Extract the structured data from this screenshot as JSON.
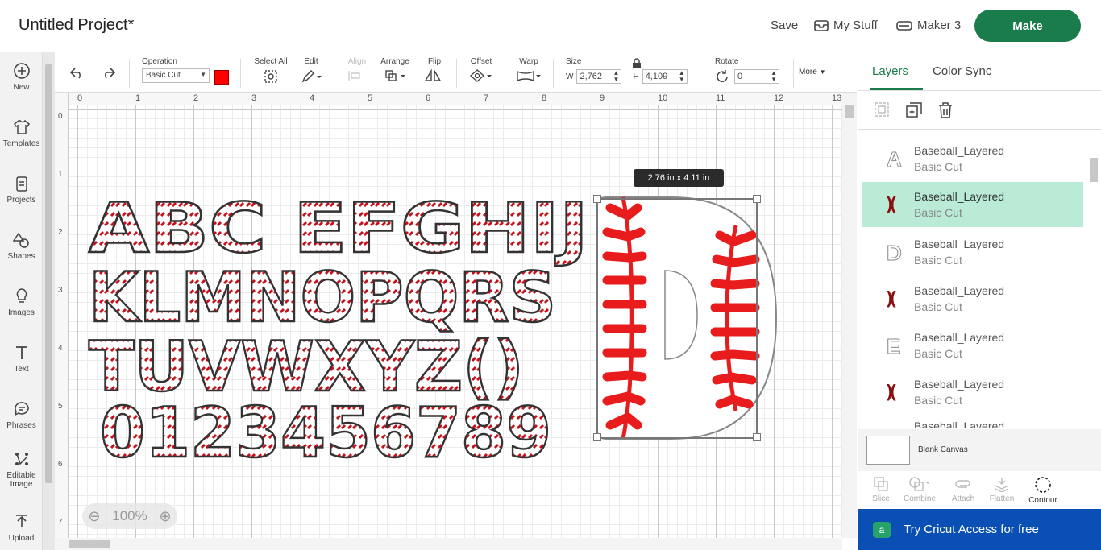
{
  "header": {
    "title": "Untitled Project*",
    "save": "Save",
    "my_stuff": "My Stuff",
    "machine": "Maker 3",
    "make": "Make"
  },
  "sidebar": {
    "items": [
      {
        "label": "New",
        "icon": "plus-circle-icon"
      },
      {
        "label": "Templates",
        "icon": "shirt-icon"
      },
      {
        "label": "Projects",
        "icon": "clipboard-icon"
      },
      {
        "label": "Shapes",
        "icon": "shapes-icon"
      },
      {
        "label": "Images",
        "icon": "lightbulb-icon"
      },
      {
        "label": "Text",
        "icon": "text-icon"
      },
      {
        "label": "Phrases",
        "icon": "chat-icon"
      },
      {
        "label": "Editable Image",
        "icon": "editable-image-icon"
      },
      {
        "label": "Upload",
        "icon": "upload-icon"
      }
    ]
  },
  "toolbar": {
    "operation_label": "Operation",
    "operation_value": "Basic Cut",
    "operation_color": "#ff0000",
    "select_all": "Select All",
    "edit": "Edit",
    "align": "Align",
    "arrange": "Arrange",
    "flip": "Flip",
    "offset": "Offset",
    "warp": "Warp",
    "size": "Size",
    "w_label": "W",
    "w_value": "2,762",
    "h_label": "H",
    "h_value": "4,109",
    "rotate": "Rotate",
    "rotate_value": "0",
    "more": "More"
  },
  "rulers": {
    "top": [
      "0",
      "1",
      "2",
      "3",
      "4",
      "5",
      "6",
      "7",
      "8",
      "9",
      "10",
      "11",
      "12",
      "13"
    ],
    "left": [
      "0",
      "1",
      "2",
      "3",
      "4",
      "5",
      "6",
      "7"
    ]
  },
  "canvas": {
    "zoom": "100%",
    "size_tooltip": "2.76  in x 4.11  in",
    "rows": [
      "ABC EFGHIJ",
      "KLMNOPQRS",
      "TUVWXYZ()",
      "0123456789"
    ],
    "big_letter": "D"
  },
  "panel": {
    "tab_layers": "Layers",
    "tab_color_sync": "Color Sync",
    "layers": [
      {
        "name": "Baseball_Layered",
        "op": "Basic Cut",
        "glyph": "A"
      },
      {
        "name": "Baseball_Layered",
        "op": "Basic Cut",
        "glyph": ")("
      },
      {
        "name": "Baseball_Layered",
        "op": "Basic Cut",
        "glyph": "D"
      },
      {
        "name": "Baseball_Layered",
        "op": "Basic Cut",
        "glyph": ")("
      },
      {
        "name": "Baseball_Layered",
        "op": "Basic Cut",
        "glyph": "E"
      },
      {
        "name": "Baseball_Layered",
        "op": "Basic Cut",
        "glyph": ")("
      },
      {
        "name": "Baseball_Layered",
        "op": "",
        "glyph": ""
      }
    ],
    "blank_canvas": "Blank Canvas",
    "bottom_tools": [
      "Slice",
      "Combine",
      "Attach",
      "Flatten",
      "Contour"
    ],
    "cricut_access": "Try Cricut Access for free"
  }
}
